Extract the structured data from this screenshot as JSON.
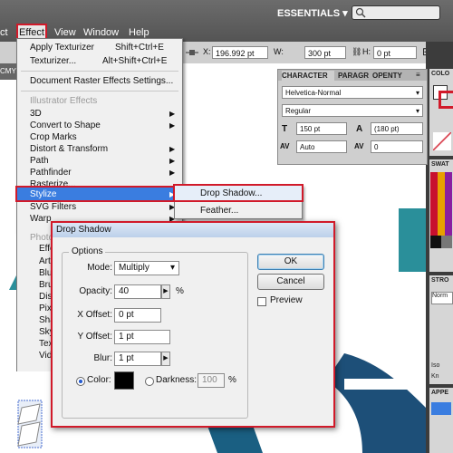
{
  "menubar": {
    "items": [
      "ct",
      "Effect",
      "View",
      "Window",
      "Help"
    ],
    "workspace": "ESSENTIALS"
  },
  "controlbar": {
    "x_value": "196.992 pt",
    "w_value": "300 pt",
    "h_value": "0 pt",
    "doc_tab": "CMY"
  },
  "effect_menu": {
    "apply_last": "Apply Texturizer",
    "apply_last_shortcut": "Shift+Ctrl+E",
    "last_effect": "Texturizer...",
    "last_effect_shortcut": "Alt+Shift+Ctrl+E",
    "doc_raster_settings": "Document Raster Effects Settings...",
    "section_illustrator": "Illustrator Effects",
    "items": [
      "3D",
      "Convert to Shape",
      "Crop Marks",
      "Distort & Transform",
      "Path",
      "Pathfinder",
      "Rasterize...",
      "Stylize",
      "SVG Filters",
      "Warp"
    ],
    "section_photoshop": "Photo",
    "photoshop_items": [
      "Effe",
      "Arti",
      "Blu",
      "Bru",
      "Dis",
      "Pix",
      "Sha",
      "Sky",
      "Tex",
      "Vid"
    ]
  },
  "stylize_submenu": {
    "items": [
      "Drop Shadow...",
      "Feather..."
    ]
  },
  "character_panel": {
    "tabs": [
      "CHARACTER",
      "PARAGR",
      "OPENTY"
    ],
    "font_family": "Helvetica-Normal",
    "font_style": "Regular",
    "font_size": "150 pt",
    "leading": "(180 pt)",
    "kerning": "Auto",
    "tracking": "0"
  },
  "right_panel": {
    "color_label": "COLO",
    "swatches_label": "SWAT",
    "stroke_label": "STRO",
    "stroke_value": "Norm",
    "iso_label": "Iso",
    "kn_label": "Kn",
    "appearance_label": "APPE"
  },
  "dialog": {
    "title": "Drop Shadow",
    "options_legend": "Options",
    "mode_label": "Mode:",
    "mode_value": "Multiply",
    "opacity_label": "Opacity:",
    "opacity_value": "40",
    "opacity_unit": "%",
    "x_offset_label": "X Offset:",
    "x_offset_value": "0 pt",
    "y_offset_label": "Y Offset:",
    "y_offset_value": "1 pt",
    "blur_label": "Blur:",
    "blur_value": "1 pt",
    "color_label": "Color:",
    "shadow_color": "#000000",
    "darkness_label": "Darkness:",
    "darkness_value": "100",
    "darkness_unit": "%",
    "ok_label": "OK",
    "cancel_label": "Cancel",
    "preview_label": "Preview"
  },
  "colors": {
    "highlight": "#3a7de0",
    "annotation_red": "#d11a2a",
    "artwork_teal": "#2a8f9a"
  }
}
